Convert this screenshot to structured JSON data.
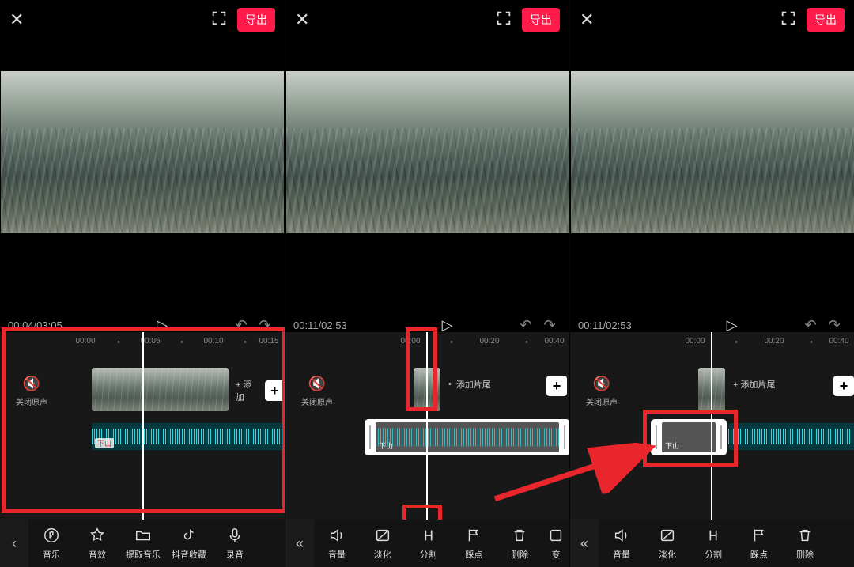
{
  "export_label": "导出",
  "panels": [
    {
      "timecode": "00:04/03:05",
      "mute_label": "关闭原声",
      "add_tail": "+ 添加",
      "audio_name": "下山",
      "ruler_ticks": [
        "00:00",
        "00:05",
        "00:10",
        "00:15"
      ],
      "toolbar": [
        {
          "icon": "music",
          "label": "音乐"
        },
        {
          "icon": "star",
          "label": "音效"
        },
        {
          "icon": "folder",
          "label": "提取音乐"
        },
        {
          "icon": "tiktok",
          "label": "抖音收藏"
        },
        {
          "icon": "mic",
          "label": "录音"
        }
      ]
    },
    {
      "timecode": "00:11/02:53",
      "mute_label": "关闭原声",
      "add_tail": "添加片尾",
      "audio_name": "下山",
      "ruler_ticks": [
        "00:00",
        "00:20",
        "00:40"
      ],
      "toolbar": [
        {
          "icon": "volume",
          "label": "音量"
        },
        {
          "icon": "fade",
          "label": "淡化"
        },
        {
          "icon": "split",
          "label": "分割"
        },
        {
          "icon": "beat",
          "label": "踩点"
        },
        {
          "icon": "trash",
          "label": "删除"
        },
        {
          "icon": "more",
          "label": "变"
        }
      ]
    },
    {
      "timecode": "00:11/02:53",
      "mute_label": "关闭原声",
      "add_tail": "+ 添加片尾",
      "audio_name": "下山",
      "ruler_ticks": [
        "00:00",
        "00:20",
        "00:40"
      ],
      "toolbar": [
        {
          "icon": "volume",
          "label": "音量"
        },
        {
          "icon": "fade",
          "label": "淡化"
        },
        {
          "icon": "split",
          "label": "分割"
        },
        {
          "icon": "beat",
          "label": "踩点"
        },
        {
          "icon": "trash",
          "label": "删除"
        }
      ]
    }
  ]
}
